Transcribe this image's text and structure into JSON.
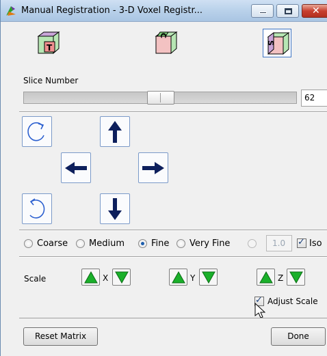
{
  "window": {
    "title": "Manual Registration - 3-D Voxel Registr..."
  },
  "views": [
    {
      "name": "transverse",
      "letter": "T",
      "selected": false
    },
    {
      "name": "coronal",
      "letter": "C",
      "selected": false
    },
    {
      "name": "sagittal",
      "letter": "S",
      "selected": true
    }
  ],
  "slice": {
    "label": "Slice Number",
    "value": "62",
    "position_fraction": 0.52
  },
  "resolution": {
    "options": [
      "Coarse",
      "Medium",
      "Fine",
      "Very Fine"
    ],
    "selected": "Fine",
    "custom_value": "1.0",
    "iso_label": "Iso",
    "iso_checked": true
  },
  "scale": {
    "label": "Scale",
    "x_label": "X",
    "y_label": "Y",
    "z_label": "Z"
  },
  "adjust_scale": {
    "label": "Adjust Scale",
    "checked": true
  },
  "buttons": {
    "reset": "Reset Matrix",
    "done": "Done"
  },
  "colors": {
    "arrow": "#0d1f5c",
    "scale_arrow": "#1ab02a",
    "rotate": "#2b5fcf"
  }
}
